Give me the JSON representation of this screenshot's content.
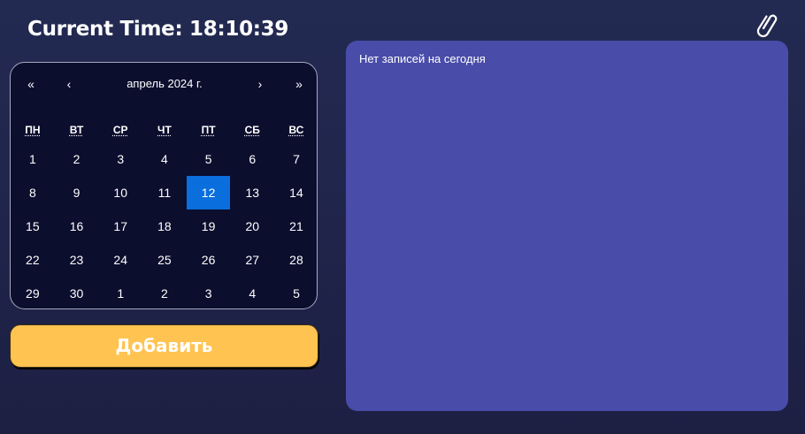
{
  "header": {
    "clock_text": "Current Time: 18:10:39",
    "attachment_icon": "paperclip-icon"
  },
  "calendar": {
    "month_label": "апрель 2024 г.",
    "nav": {
      "prev_year": "«",
      "prev_month": "‹",
      "next_month": "›",
      "next_year": "»"
    },
    "weekdays": [
      "ПН",
      "ВТ",
      "СР",
      "ЧТ",
      "ПТ",
      "СБ",
      "ВС"
    ],
    "days": [
      "1",
      "2",
      "3",
      "4",
      "5",
      "6",
      "7",
      "8",
      "9",
      "10",
      "11",
      "12",
      "13",
      "14",
      "15",
      "16",
      "17",
      "18",
      "19",
      "20",
      "21",
      "22",
      "23",
      "24",
      "25",
      "26",
      "27",
      "28",
      "29",
      "30",
      "1",
      "2",
      "3",
      "4",
      "5"
    ],
    "selected_day": "12",
    "selected_color": "#0a6fdc"
  },
  "actions": {
    "add_label": "Добавить"
  },
  "notes": {
    "empty_text": "Нет записей на сегодня"
  },
  "colors": {
    "background": "#1f2449",
    "calendar_bg": "#0c0e2e",
    "panel_bg": "#494ca9",
    "button_bg": "#ffc352"
  }
}
